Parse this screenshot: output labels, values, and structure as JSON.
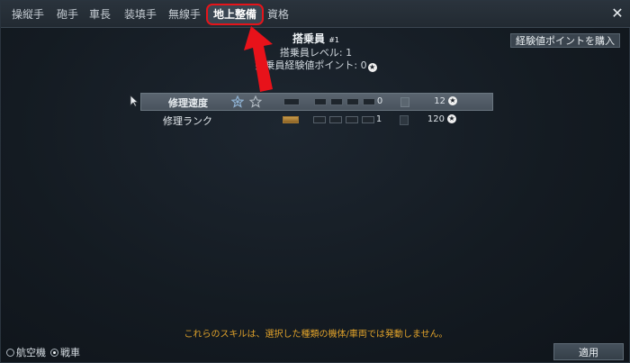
{
  "tabs": [
    {
      "label": "操縦手"
    },
    {
      "label": "砲手"
    },
    {
      "label": "車長"
    },
    {
      "label": "装填手"
    },
    {
      "label": "無線手"
    },
    {
      "label": "地上整備"
    },
    {
      "label": "資格"
    }
  ],
  "active_tab": "地上整備",
  "buy_exp_label": "経験値ポイントを購入",
  "crew": {
    "title": "搭乗員",
    "number": "#1",
    "level_text": "搭乗員レベル: 1",
    "exp_label": "搭乗員経験値ポイント: 0"
  },
  "skills": [
    {
      "name": "修理速度",
      "level": "0",
      "cost": "12",
      "progress_filled": 0,
      "progress_total": 5
    },
    {
      "name": "修理ランク",
      "level": "1",
      "cost": "120",
      "progress_filled": 1,
      "progress_total": 5
    }
  ],
  "notice": "これらのスキルは、選択した種類の機体/車両では発動しません。",
  "vehicle_types": [
    {
      "label": "航空機",
      "selected": false
    },
    {
      "label": "戦車",
      "selected": true
    }
  ],
  "apply_label": "適用",
  "colors": {
    "accent_red": "#e5141a",
    "notice": "#e0a22a",
    "progress_fill": "#c79a4a"
  }
}
